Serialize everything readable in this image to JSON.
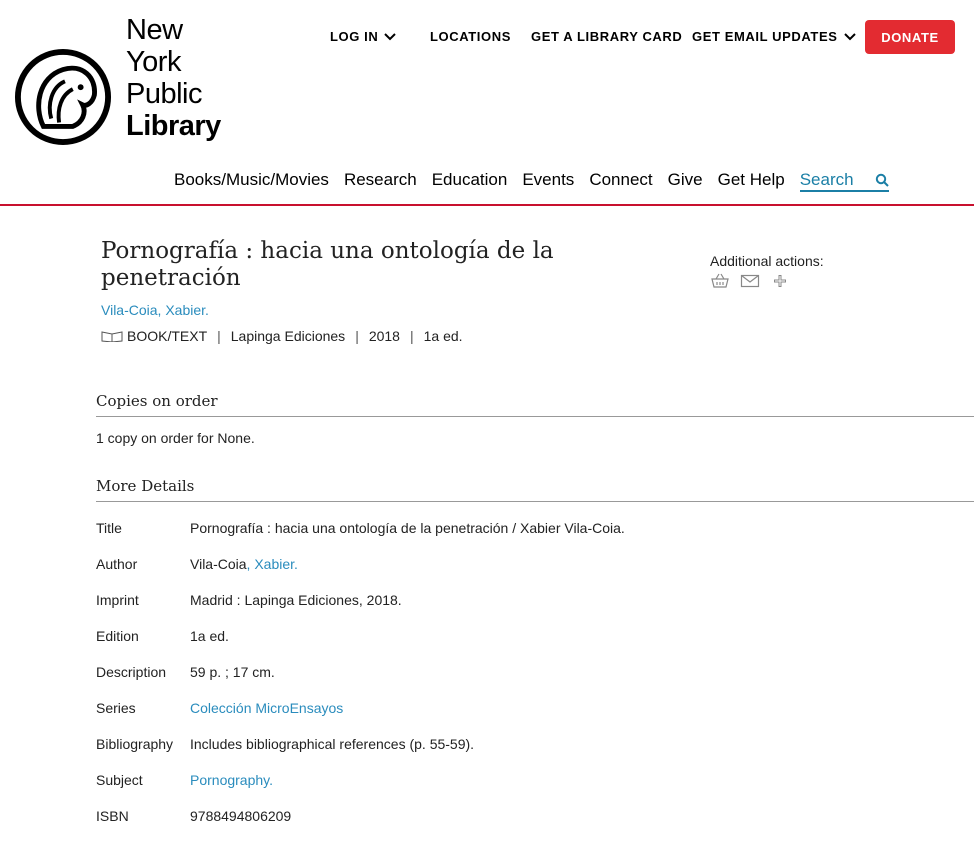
{
  "logo": {
    "line1": "New York",
    "line2": "Public",
    "line3": "Library"
  },
  "utility_nav": {
    "login": "LOG IN",
    "locations": "LOCATIONS",
    "library_card": "GET A LIBRARY CARD",
    "email_updates": "GET EMAIL UPDATES",
    "donate": "DONATE"
  },
  "main_nav": [
    "Books/Music/Movies",
    "Research",
    "Education",
    "Events",
    "Connect",
    "Give",
    "Get Help",
    "Search"
  ],
  "record": {
    "title": "Pornografía : hacia una ontología de la penetración",
    "author": "Vila-Coia, Xabier.",
    "format": "BOOK/TEXT",
    "publisher": "Lapinga Ediciones",
    "year": "2018",
    "edition": "1a ed."
  },
  "actions": {
    "label": "Additional actions:"
  },
  "copies": {
    "heading": "Copies on order",
    "text": "1 copy on order for None."
  },
  "details": {
    "heading": "More Details",
    "rows": [
      {
        "label": "Title",
        "value": "Pornografía : hacia una ontología de la penetración / Xabier Vila-Coia."
      },
      {
        "label": "Author",
        "value_plain": "Vila-Coia",
        "value_link": ", Xabier."
      },
      {
        "label": "Imprint",
        "value": "Madrid : Lapinga Ediciones, 2018."
      },
      {
        "label": "Edition",
        "value": "1a ed."
      },
      {
        "label": "Description",
        "value": "59 p. ; 17 cm."
      },
      {
        "label": "Series",
        "value": "Colección MicroEnsayos"
      },
      {
        "label": "Bibliography",
        "value": "Includes bibliographical references (p. 55-59)."
      },
      {
        "label": "Subject",
        "value": "Pornography."
      },
      {
        "label": "ISBN",
        "value": "9788494806209"
      }
    ]
  },
  "colors": {
    "accent_red": "#e32b31",
    "link_blue": "#2a8cbd",
    "divider_red": "#c8102e"
  },
  "icons": [
    "nypl-lion-logo",
    "chevron-down-icon",
    "search-icon",
    "book-icon",
    "basket-icon",
    "envelope-icon",
    "plus-icon"
  ]
}
